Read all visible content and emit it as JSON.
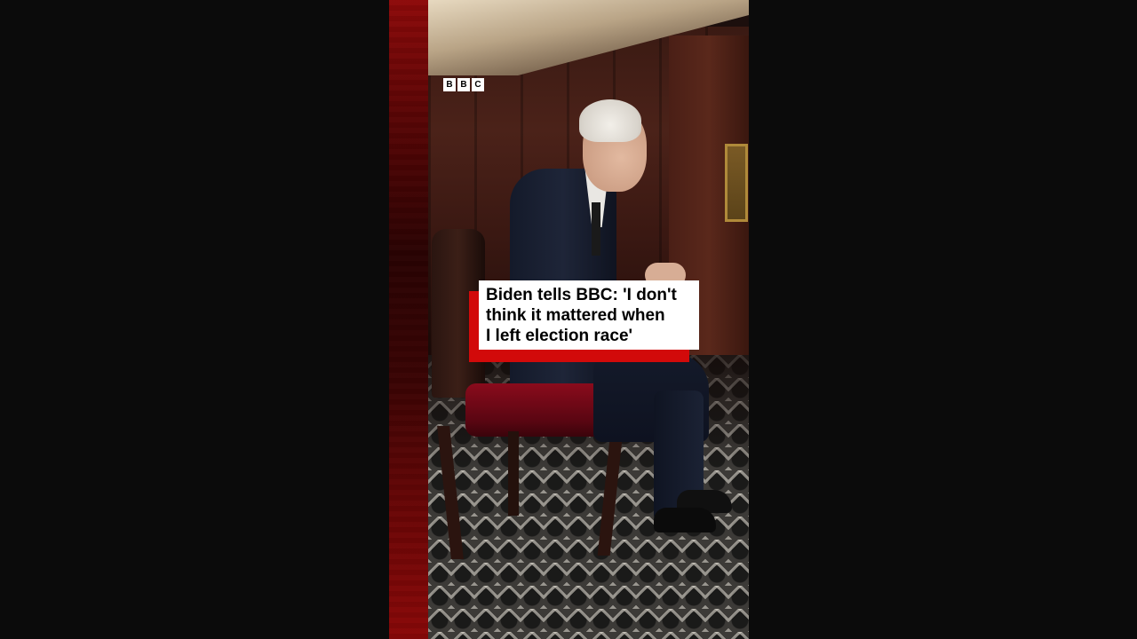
{
  "logo": {
    "letters": [
      "B",
      "B",
      "C"
    ]
  },
  "headline": {
    "lines": [
      "Biden tells BBC: 'I don't",
      "think it mattered when",
      "I left election race'"
    ]
  },
  "colors": {
    "accent_red": "#d20a0a",
    "caption_bg": "#ffffff",
    "letterbox": "#0b0b0b"
  }
}
